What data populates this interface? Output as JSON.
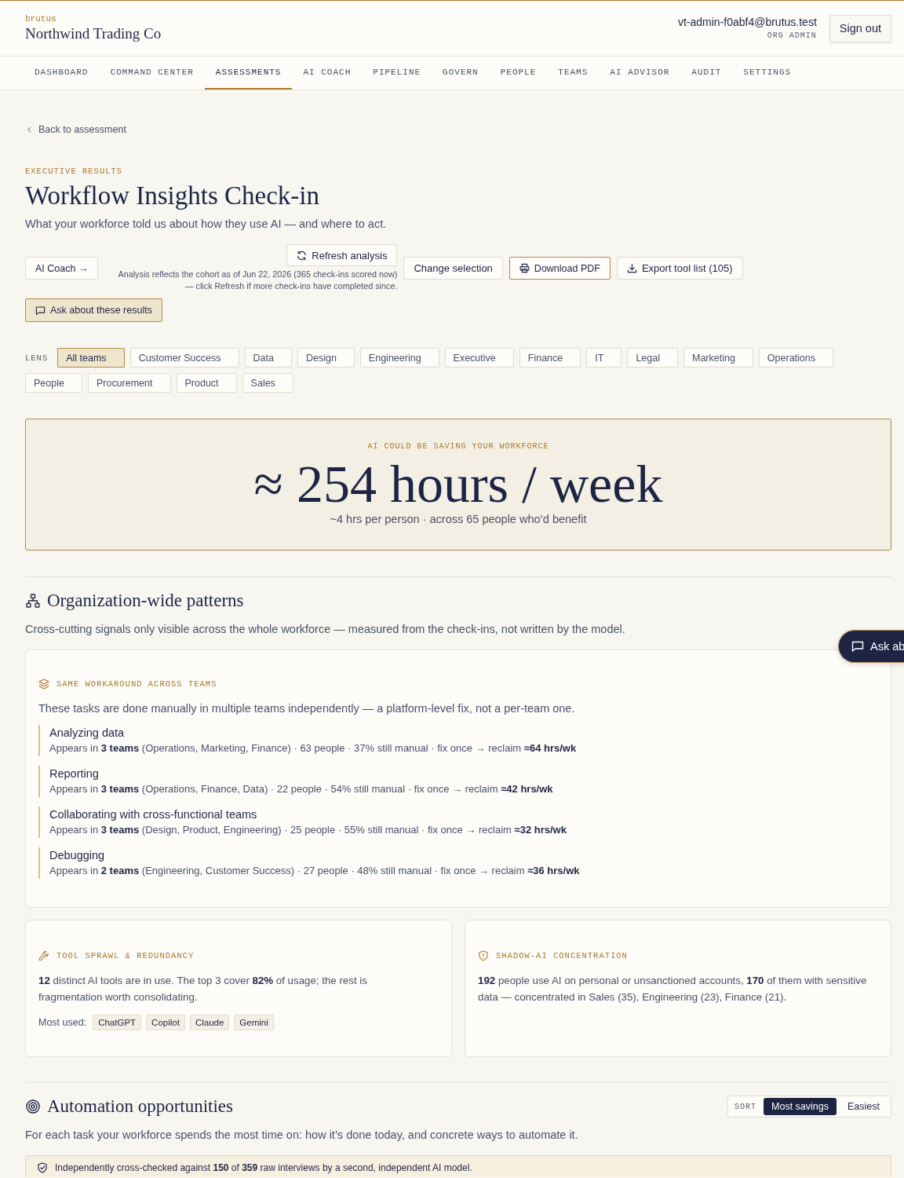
{
  "header": {
    "brand": "brutus",
    "org_name": "Northwind Trading Co",
    "user_email": "vt-admin-f0abf4@brutus.test",
    "user_role": "ORG ADMIN",
    "sign_out": "Sign out"
  },
  "nav": [
    {
      "label": "DASHBOARD",
      "selected": false
    },
    {
      "label": "COMMAND CENTER",
      "selected": false
    },
    {
      "label": "ASSESSMENTS",
      "selected": true
    },
    {
      "label": "AI COACH",
      "selected": false
    },
    {
      "label": "PIPELINE",
      "selected": false
    },
    {
      "label": "GOVERN",
      "selected": false
    },
    {
      "label": "PEOPLE",
      "selected": false
    },
    {
      "label": "TEAMS",
      "selected": false
    },
    {
      "label": "AI ADVISOR",
      "selected": false
    },
    {
      "label": "AUDIT",
      "selected": false
    },
    {
      "label": "SETTINGS",
      "selected": false
    }
  ],
  "back_link": "Back to assessment",
  "eyebrow": "EXECUTIVE RESULTS",
  "title": "Workflow Insights Check-in",
  "subtitle": "What your workforce told us about how they use AI — and where to act.",
  "actions": {
    "ai_coach": "AI Coach →",
    "refresh": "Refresh analysis",
    "analysis_note": "Analysis reflects the cohort as of Jun 22, 2026 (365 check-ins scored now) — click Refresh if more check-ins have completed since.",
    "change_selection": "Change selection",
    "download_pdf": "Download PDF",
    "export": "Export tool list (105)",
    "ask": "Ask about these results"
  },
  "lens": {
    "label": "LENS",
    "options": [
      {
        "label": "All teams",
        "selected": true
      },
      {
        "label": "Customer Success",
        "selected": false
      },
      {
        "label": "Data",
        "selected": false
      },
      {
        "label": "Design",
        "selected": false
      },
      {
        "label": "Engineering",
        "selected": false
      },
      {
        "label": "Executive",
        "selected": false
      },
      {
        "label": "Finance",
        "selected": false
      },
      {
        "label": "IT",
        "selected": false
      },
      {
        "label": "Legal",
        "selected": false
      },
      {
        "label": "Marketing",
        "selected": false
      },
      {
        "label": "Operations",
        "selected": false
      },
      {
        "label": "People",
        "selected": false
      },
      {
        "label": "Procurement",
        "selected": false
      },
      {
        "label": "Product",
        "selected": false
      },
      {
        "label": "Sales",
        "selected": false
      }
    ]
  },
  "savings_banner": {
    "eyebrow": "AI COULD BE SAVING YOUR WORKFORCE",
    "headline": "≈ 254 hours / week",
    "detail": "~4 hrs per person · across 65 people who’d benefit"
  },
  "org_patterns": {
    "title": "Organization-wide patterns",
    "description": "Cross-cutting signals only visible across the whole workforce — measured from the check-ins, not written by the model.",
    "workaround": {
      "label": "SAME WORKAROUND ACROSS TEAMS",
      "description": "These tasks are done manually in multiple teams independently — a platform-level fix, not a per-team one.",
      "items": [
        {
          "task": "Analyzing data",
          "detail": "Appears in **3 teams** (Operations, Marketing, Finance) · 63 people · 37% still manual · fix once → reclaim **≈64 hrs/wk**"
        },
        {
          "task": "Reporting",
          "detail": "Appears in **3 teams** (Operations, Finance, Data) · 22 people · 54% still manual · fix once → reclaim **≈42 hrs/wk**"
        },
        {
          "task": "Collaborating with cross-functional teams",
          "detail": "Appears in **3 teams** (Design, Product, Engineering) · 25 people · 55% still manual · fix once → reclaim **≈32 hrs/wk**"
        },
        {
          "task": "Debugging",
          "detail": "Appears in **2 teams** (Engineering, Customer Success) · 27 people · 48% still manual · fix once → reclaim **≈36 hrs/wk**"
        }
      ]
    },
    "tool_sprawl": {
      "label": "TOOL SPRAWL & REDUNDANCY",
      "text": "**12** distinct AI tools are in use. The top 3 cover **82%** of usage; the rest is fragmentation worth consolidating.",
      "most_used_label": "Most used:",
      "tools": [
        "ChatGPT",
        "Copilot",
        "Claude",
        "Gemini"
      ]
    },
    "shadow_ai": {
      "label": "SHADOW-AI CONCENTRATION",
      "text": "**192** people use AI on personal or unsanctioned accounts, **170** of them with sensitive data — concentrated in Sales (35), Engineering (23), Finance (21)."
    }
  },
  "floating_ask": "Ask ab",
  "automation": {
    "title": "Automation opportunities",
    "sort": {
      "label": "SORT",
      "options": [
        {
          "label": "Most savings",
          "selected": true
        },
        {
          "label": "Easiest",
          "selected": false
        }
      ]
    },
    "description": "For each task your workforce spends the most time on: how it’s done today, and concrete ways to automate it.",
    "verification": "Independently cross-checked against **150** of **359** raw interviews by a second, independent AI model."
  }
}
